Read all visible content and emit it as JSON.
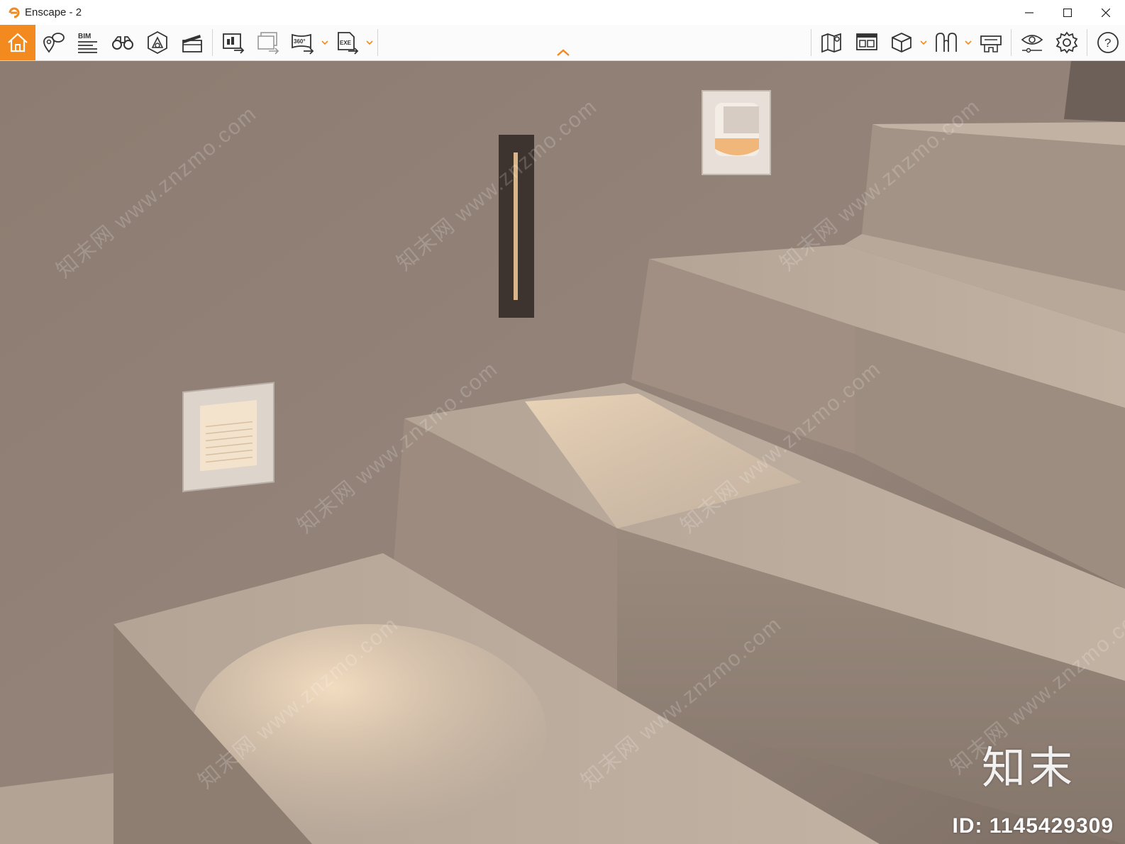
{
  "window": {
    "title": "Enscape - 2",
    "controls": [
      "minimize-icon",
      "maximize-icon",
      "close-icon"
    ]
  },
  "toolbar": {
    "left_tools": [
      {
        "name": "home",
        "icon": "home-icon",
        "active": true
      },
      {
        "name": "views",
        "icon": "location-pin-icon"
      },
      {
        "name": "bim",
        "icon": "bim-icon",
        "label": "BIM"
      },
      {
        "name": "walk-mode",
        "icon": "binoculars-icon"
      },
      {
        "name": "objects",
        "icon": "asset-library-icon"
      },
      {
        "name": "video-editor",
        "icon": "clapperboard-icon"
      },
      {
        "name": "screenshot",
        "icon": "render-export-icon"
      },
      {
        "name": "batch-render",
        "icon": "batch-render-icon"
      },
      {
        "name": "panorama",
        "icon": "panorama-icon",
        "label": "360°"
      },
      {
        "name": "export-exe",
        "icon": "export-exe-icon",
        "label": "EXE"
      }
    ],
    "right_tools": [
      {
        "name": "map",
        "icon": "map-icon"
      },
      {
        "name": "mini-map",
        "icon": "minimap-icon"
      },
      {
        "name": "views-box",
        "icon": "cube-icon"
      },
      {
        "name": "vr",
        "icon": "vr-icon"
      },
      {
        "name": "headset",
        "icon": "headset-icon"
      },
      {
        "name": "visual-settings",
        "icon": "eye-settings-icon"
      },
      {
        "name": "settings",
        "icon": "gear-icon"
      },
      {
        "name": "help",
        "icon": "help-icon",
        "label": "?"
      }
    ],
    "accent_color": "#f28a1f"
  },
  "viewport": {
    "watermark_text": "知末网 www.znzmo.com",
    "brand_text": "知末",
    "id_text": "ID: 1145429309"
  }
}
